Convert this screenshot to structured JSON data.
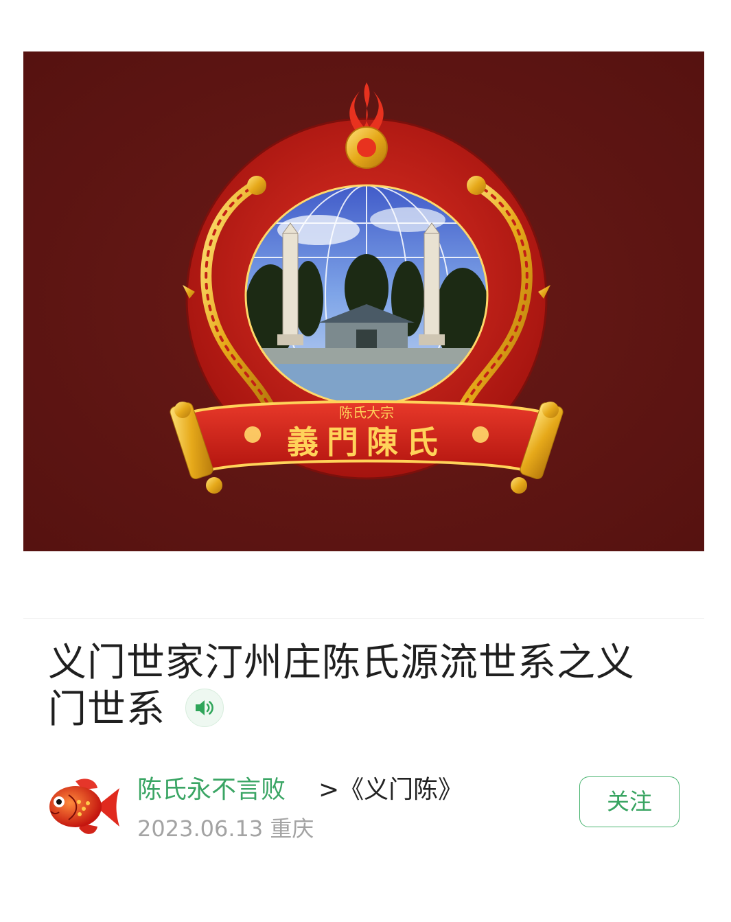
{
  "article": {
    "title": "义门世家汀州庄陈氏源流世系之义门世系",
    "audio_icon": "speaker-icon"
  },
  "cover": {
    "banner_small_text": "陈氏大宗",
    "banner_main_text": "義門陳氏",
    "background_color": "#5e1513"
  },
  "author": {
    "name": "陈氏永不言败",
    "collection": ">《义门陈》",
    "date": "2023.06.13",
    "location": "重庆",
    "follow_label": "关注",
    "avatar_icon": "goldfish-icon"
  },
  "colors": {
    "accent_green": "#3aa564",
    "meta_gray": "#a3a3a3",
    "title_text": "#1f1f1f"
  }
}
